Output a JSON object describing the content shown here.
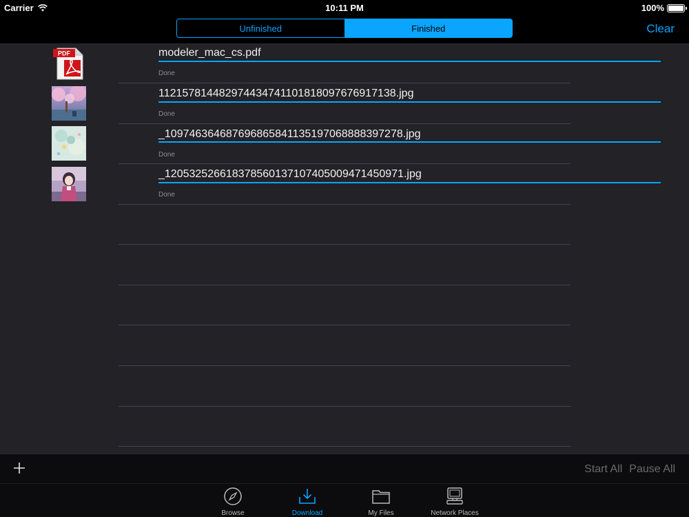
{
  "status_bar": {
    "carrier": "Carrier",
    "time": "10:11 PM",
    "battery": "100%"
  },
  "nav": {
    "segments": [
      "Unfinished",
      "Finished"
    ],
    "selected_segment": "Finished",
    "clear_label": "Clear"
  },
  "files": [
    {
      "name": "modeler_mac_cs.pdf",
      "status": "Done",
      "icon": "pdf-icon"
    },
    {
      "name": "1121578144829744347411018180976769171​38.jpg",
      "status": "Done",
      "icon": "image-thumbnail"
    },
    {
      "name": "_10974636468769686584113519706888839​7278.jpg",
      "status": "Done",
      "icon": "image-thumbnail"
    },
    {
      "name": "_12053252661837856013710740500947145​0971.jpg",
      "status": "Done",
      "icon": "image-thumbnail"
    }
  ],
  "toolbar": {
    "add_icon": "plus-icon",
    "start_all": "Start All",
    "pause_all": "Pause All"
  },
  "tabs": [
    {
      "label": "Browse",
      "icon": "compass-icon",
      "active": false
    },
    {
      "label": "Download",
      "icon": "download-icon",
      "active": true
    },
    {
      "label": "My Files",
      "icon": "folder-icon",
      "active": false
    },
    {
      "label": "Network Places",
      "icon": "computer-icon",
      "active": false
    }
  ],
  "colors": {
    "accent": "#0aa5ff",
    "list_background": "#222227",
    "bar_background": "#000000"
  }
}
